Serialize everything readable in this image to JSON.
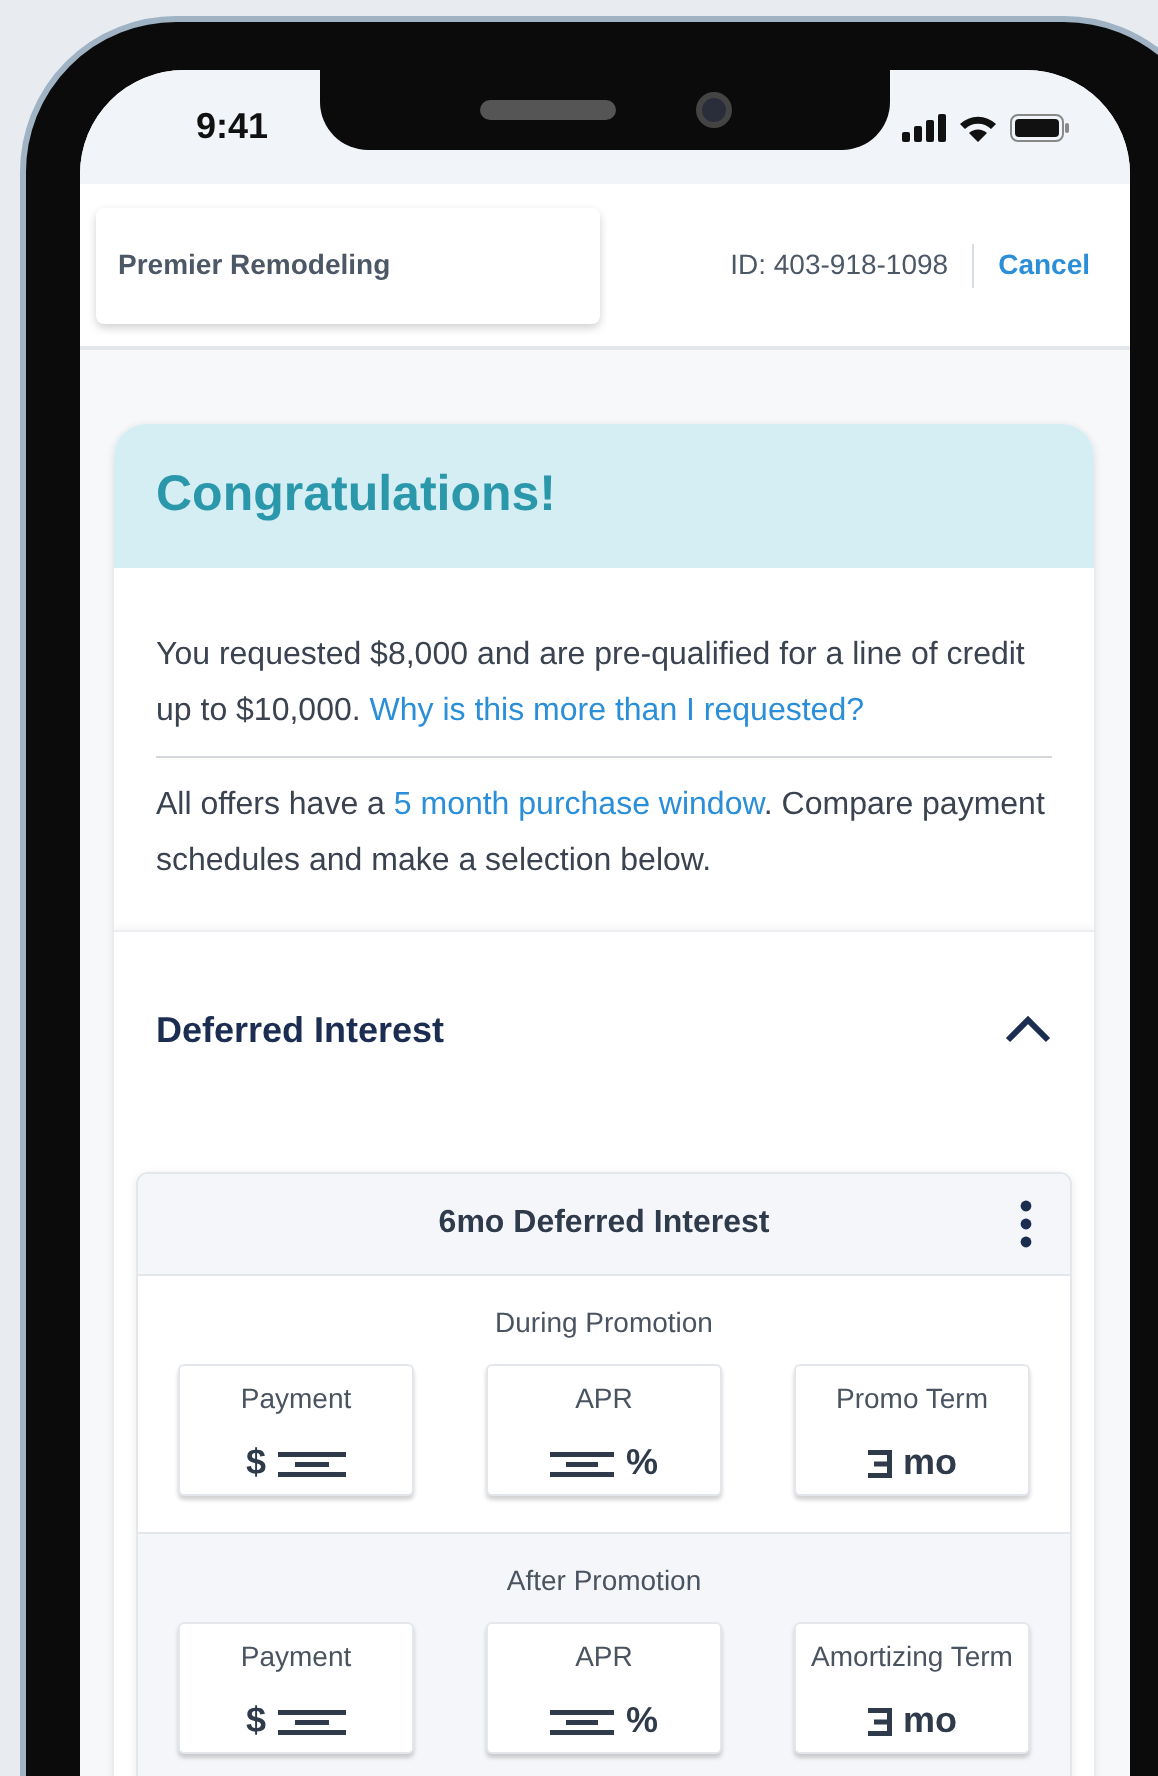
{
  "status_bar": {
    "time": "9:41"
  },
  "header": {
    "merchant": "Premier Remodeling",
    "id": "ID: 403-918-1098",
    "cancel": "Cancel"
  },
  "banner": {
    "title": "Congratulations!"
  },
  "message": {
    "text": "You requested $8,000 and are pre-qualified for a line of credit up to $10,000.",
    "link": "Why is this more than I requested?"
  },
  "note": {
    "before": "All offers have a ",
    "link": "5 month purchase window",
    "after": ". Compare payment schedules and make a selection below."
  },
  "section": {
    "title": "Deferred Interest",
    "expanded": true
  },
  "offer": {
    "title": "6mo Deferred Interest",
    "groups": [
      {
        "title": "During Promotion",
        "tiles": [
          {
            "label": "Payment",
            "kind": "payment",
            "unit": "$"
          },
          {
            "label": "APR",
            "kind": "rate",
            "unit": "%"
          },
          {
            "label": "Promo Term",
            "kind": "term",
            "unit": "mo"
          }
        ]
      },
      {
        "title": "After Promotion",
        "tiles": [
          {
            "label": "Payment",
            "kind": "payment",
            "unit": "$"
          },
          {
            "label": "APR",
            "kind": "rate",
            "unit": "%"
          },
          {
            "label": "Amortizing Term",
            "kind": "term",
            "unit": "mo"
          }
        ]
      }
    ]
  }
}
